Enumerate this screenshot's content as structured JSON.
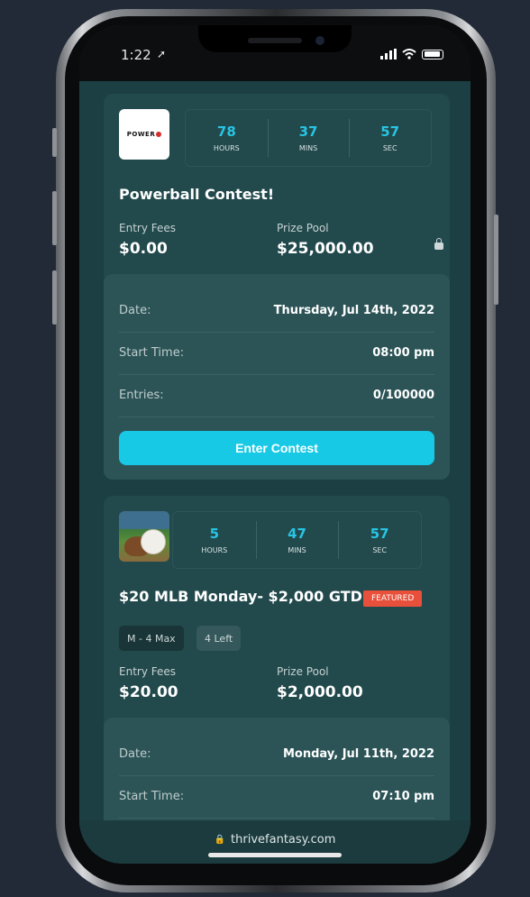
{
  "status_bar": {
    "time": "1:22",
    "location_icon": "location-arrow-icon"
  },
  "contests": [
    {
      "logo": "powerball-logo",
      "logo_text": "POWER",
      "timer": {
        "hours": "78",
        "hours_label": "HOURS",
        "mins": "37",
        "mins_label": "MINS",
        "sec": "57",
        "sec_label": "SEC"
      },
      "title": "Powerball Contest!",
      "entry_fees_label": "Entry Fees",
      "entry_fees": "$0.00",
      "prize_pool_label": "Prize Pool",
      "prize_pool": "$25,000.00",
      "details": {
        "date_label": "Date:",
        "date": "Thursday, Jul 14th, 2022",
        "start_label": "Start Time:",
        "start": "08:00 pm",
        "entries_label": "Entries:",
        "entries": "0/100000"
      },
      "button": "Enter Contest"
    },
    {
      "logo": "baseball-image",
      "timer": {
        "hours": "5",
        "hours_label": "HOURS",
        "mins": "47",
        "mins_label": "MINS",
        "sec": "57",
        "sec_label": "SEC"
      },
      "title": "$20 MLB Monday- $2,000 GTD",
      "badge": "FEATURED",
      "pills": [
        "M - 4 Max",
        "4 Left"
      ],
      "entry_fees_label": "Entry Fees",
      "entry_fees": "$20.00",
      "prize_pool_label": "Prize Pool",
      "prize_pool": "$2,000.00",
      "details": {
        "date_label": "Date:",
        "date": "Monday, Jul 11th, 2022",
        "start_label": "Start Time:",
        "start": "07:10 pm"
      }
    }
  ],
  "url_bar": {
    "url": "thrivefantasy.com"
  },
  "colors": {
    "accent": "#18c9e6",
    "badge": "#e8503b",
    "background": "#1c3f43",
    "card": "#22494c"
  }
}
